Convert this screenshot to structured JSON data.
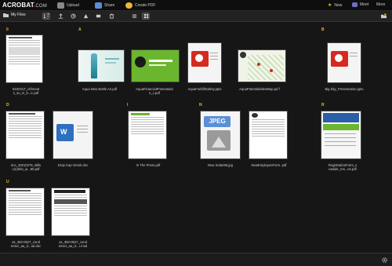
{
  "app": {
    "logo": "ACROBAT",
    "logo_domain": "COM",
    "nav": {
      "upload": "Upload",
      "share": "Share",
      "create_pdf": "Create PDF",
      "new": "New",
      "meet": "Meet",
      "more": "More"
    }
  },
  "toolbar": {
    "my_files": "My Files"
  },
  "index_letters": [
    "0",
    "A",
    "B",
    "D",
    "I",
    "N",
    "R",
    "U"
  ],
  "files": [
    {
      "caption": "0S3041T_chfreeat s_su_ni_b...ic.pdf"
    },
    {
      "caption": "Aqua New Bottle A4.pdf"
    },
    {
      "caption": "AquaFinancialPresentatio n_c.pdf"
    },
    {
      "caption": "AquaForkliftSafety.pptx"
    },
    {
      "caption": "AquaPotentialSitesMap.pd f"
    },
    {
      "caption": "Big Sky_Presentation.pptx"
    },
    {
      "caption": "doc_20010279_stills c(o)rbio_ia...80.pdf"
    },
    {
      "caption": "Drop Cap Greek.doc"
    },
    {
      "caption": "In The Press.pdf"
    },
    {
      "caption": "New SolarHB.jpg"
    },
    {
      "caption": "NewEmployeeForm. pdf"
    },
    {
      "caption": "RegistrationForm_s easide_res...es.pdf"
    },
    {
      "caption": "us_350-0527_cond enser_aa_iz...ial.doc"
    },
    {
      "caption": "us_350-0527_cond enser_aa_iz...i.mod"
    }
  ],
  "colors": {
    "accent": "#e8b83a",
    "background": "#161616",
    "pdf_red": "#d42a1f",
    "green": "#6ab62e"
  }
}
